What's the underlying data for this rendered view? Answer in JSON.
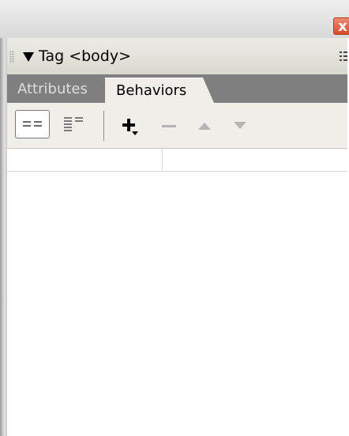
{
  "window": {
    "close_label": "x"
  },
  "header": {
    "title": "Tag <body>"
  },
  "tabs": [
    {
      "label": "Attributes",
      "active": false
    },
    {
      "label": "Behaviors",
      "active": true
    }
  ],
  "toolbar": {
    "show_set_events_icon": "show-set-events-icon",
    "show_all_events_icon": "show-all-events-icon",
    "add_behavior_icon": "add-behavior-icon",
    "remove_behavior_icon": "remove-behavior-icon",
    "move_up_icon": "move-up-icon",
    "move_down_icon": "move-down-icon"
  },
  "behaviors_list": {
    "columns": [
      "",
      ""
    ],
    "rows": []
  },
  "colors": {
    "tab_bar": "#7f7f7f",
    "active_tab": "#efeee9",
    "close_button": "#d84b2c"
  }
}
